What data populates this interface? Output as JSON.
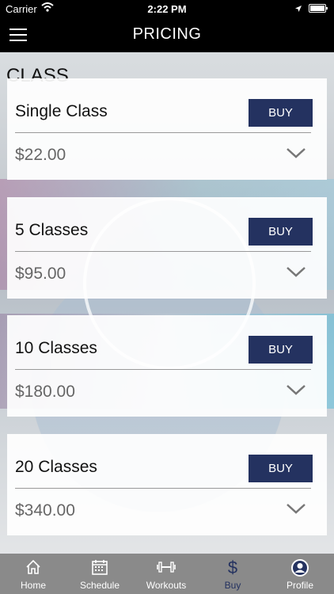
{
  "status_bar": {
    "carrier": "Carrier",
    "time": "2:22 PM"
  },
  "nav": {
    "title": "PRICING",
    "menu_icon": "hamburger-menu-icon"
  },
  "section_title": "CLASS",
  "cards": [
    {
      "name": "Single Class",
      "price": "$22.00",
      "buy_label": "BUY"
    },
    {
      "name": "5 Classes",
      "price": "$95.00",
      "buy_label": "BUY"
    },
    {
      "name": "10 Classes",
      "price": "$180.00",
      "buy_label": "BUY"
    },
    {
      "name": "20 Classes",
      "price": "$340.00",
      "buy_label": "BUY"
    }
  ],
  "tabs": [
    {
      "label": "Home",
      "icon": "home-icon"
    },
    {
      "label": "Schedule",
      "icon": "calendar-icon"
    },
    {
      "label": "Workouts",
      "icon": "dumbbell-icon"
    },
    {
      "label": "Buy",
      "icon": "dollar-icon",
      "active": true
    },
    {
      "label": "Profile",
      "icon": "profile-icon"
    }
  ],
  "colors": {
    "accent": "#243260",
    "tab_bar": "#8a8a8a",
    "header": "#000000"
  }
}
